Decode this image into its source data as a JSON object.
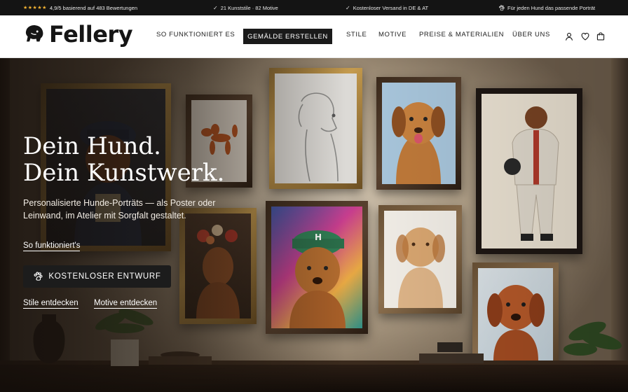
{
  "topbar": {
    "rating_stars": "★★★★★",
    "rating_text": "4,9/5 basierend auf 483 Bewertungen",
    "styles_text": "21 Kunststile · 82 Motive",
    "shipping_text": "Kostenloser Versand in DE & AT",
    "portrait_text": "Für jeden Hund das passende Porträt"
  },
  "header": {
    "logo_text": "Fellery",
    "nav": {
      "how": "SO FUNKTIONIERT ES",
      "create": "GEMÄLDE ERSTELLEN",
      "styles": "STILE",
      "motifs": "MOTIVE",
      "prices": "PREISE & MATERIALIEN",
      "about": "ÜBER UNS"
    }
  },
  "hero": {
    "title_line1": "Dein Hund.",
    "title_line2": "Dein Kunstwerk.",
    "subtitle_line1": "Personalisierte Hunde-Porträts — als Poster oder",
    "subtitle_line2": "Leinwand, im Atelier mit Sorgfalt gestaltet.",
    "how_link": "So funktioniert's",
    "cta_label": "KOSTENLOSER ENTWURF",
    "styles_link": "Stile entdecken",
    "motifs_link": "Motive entdecken"
  },
  "colors": {
    "topbar_bg": "#141414",
    "cta_bg": "#1a1a1a",
    "star": "#f2b233"
  }
}
